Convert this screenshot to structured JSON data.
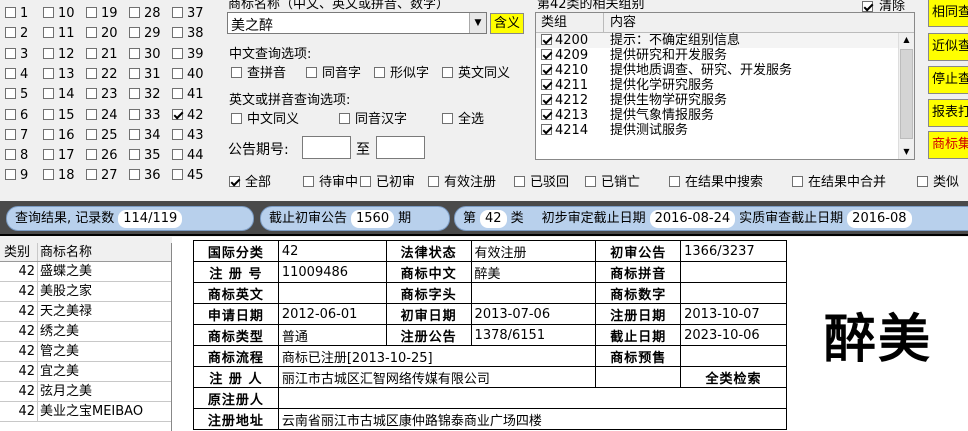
{
  "classes": [
    {
      "num": "1",
      "checked": false
    },
    {
      "num": "10",
      "checked": false
    },
    {
      "num": "19",
      "checked": false
    },
    {
      "num": "28",
      "checked": false
    },
    {
      "num": "37",
      "checked": false
    },
    {
      "num": "2",
      "checked": false
    },
    {
      "num": "11",
      "checked": false
    },
    {
      "num": "20",
      "checked": false
    },
    {
      "num": "29",
      "checked": false
    },
    {
      "num": "38",
      "checked": false
    },
    {
      "num": "3",
      "checked": false
    },
    {
      "num": "12",
      "checked": false
    },
    {
      "num": "21",
      "checked": false
    },
    {
      "num": "30",
      "checked": false
    },
    {
      "num": "39",
      "checked": false
    },
    {
      "num": "4",
      "checked": false
    },
    {
      "num": "13",
      "checked": false
    },
    {
      "num": "22",
      "checked": false
    },
    {
      "num": "31",
      "checked": false
    },
    {
      "num": "40",
      "checked": false
    },
    {
      "num": "5",
      "checked": false
    },
    {
      "num": "14",
      "checked": false
    },
    {
      "num": "23",
      "checked": false
    },
    {
      "num": "32",
      "checked": false
    },
    {
      "num": "41",
      "checked": false
    },
    {
      "num": "6",
      "checked": false
    },
    {
      "num": "15",
      "checked": false
    },
    {
      "num": "24",
      "checked": false
    },
    {
      "num": "33",
      "checked": false
    },
    {
      "num": "42",
      "checked": true
    },
    {
      "num": "7",
      "checked": false
    },
    {
      "num": "16",
      "checked": false
    },
    {
      "num": "25",
      "checked": false
    },
    {
      "num": "34",
      "checked": false
    },
    {
      "num": "43",
      "checked": false
    },
    {
      "num": "8",
      "checked": false
    },
    {
      "num": "17",
      "checked": false
    },
    {
      "num": "26",
      "checked": false
    },
    {
      "num": "35",
      "checked": false
    },
    {
      "num": "44",
      "checked": false
    },
    {
      "num": "9",
      "checked": false
    },
    {
      "num": "18",
      "checked": false
    },
    {
      "num": "27",
      "checked": false
    },
    {
      "num": "36",
      "checked": false
    },
    {
      "num": "45",
      "checked": false
    }
  ],
  "search": {
    "top_label": "商标名称（中文、英文或拼音、数字）",
    "name_value": "美之醉",
    "meaning_button": "含义",
    "cn_options_label": "中文查询选项:",
    "cn_opts": [
      "查拼音",
      "同音字",
      "形似字",
      "英文同义"
    ],
    "en_options_label": "英文或拼音查询选项:",
    "en_opts": [
      "中文同义",
      "同音汉字",
      "全选"
    ],
    "gazette_label": "公告期号:",
    "to_label": "至",
    "from_value": "",
    "to_value": ""
  },
  "group_panel": {
    "title": "第42类的相关组别",
    "clear_label": "清除",
    "col_group": "类组",
    "col_content": "内容",
    "rows": [
      {
        "code": "4200",
        "content": "提示：不确定组别信息",
        "checked": true
      },
      {
        "code": "4209",
        "content": "提供研究和开发服务",
        "checked": true
      },
      {
        "code": "4210",
        "content": "提供地质调查、研究、开发服务",
        "checked": true
      },
      {
        "code": "4211",
        "content": "提供化学研究服务",
        "checked": true
      },
      {
        "code": "4212",
        "content": "提供生物学研究服务",
        "checked": true
      },
      {
        "code": "4213",
        "content": "提供气象情报服务",
        "checked": true
      },
      {
        "code": "4214",
        "content": "提供测试服务",
        "checked": true
      }
    ]
  },
  "side_buttons": [
    "相同查",
    "近似查",
    "停止查",
    "报表打",
    "商标集"
  ],
  "filters": [
    {
      "label": "全部",
      "checked": true
    },
    {
      "label": "待审中",
      "checked": false
    },
    {
      "label": "已初审",
      "checked": false
    },
    {
      "label": "有效注册",
      "checked": false
    },
    {
      "label": "已驳回",
      "checked": false
    },
    {
      "label": "已销亡",
      "checked": false
    },
    {
      "label": "在结果中搜索",
      "checked": false
    },
    {
      "label": "在结果中合并",
      "checked": false
    },
    {
      "label": "类似",
      "checked": false
    }
  ],
  "status": {
    "result_label": "查询结果, 记录数",
    "result_value": "114/119",
    "deadline_label": "截止初审公告",
    "deadline_value": "1560",
    "deadline_unit": "期",
    "class_prefix": "第",
    "class_value": "42",
    "class_suffix": "类",
    "prelim_label": "初步审定截止日期",
    "prelim_value": "2016-08-24",
    "substantive_label": "实质审查截止日期",
    "substantive_value": "2016-08"
  },
  "list": {
    "col_class": "类别",
    "col_name": "商标名称",
    "rows": [
      {
        "cls": "42",
        "name": "盛蝶之美"
      },
      {
        "cls": "42",
        "name": "美股之家"
      },
      {
        "cls": "42",
        "name": "天之美禄"
      },
      {
        "cls": "42",
        "name": "绣之美"
      },
      {
        "cls": "42",
        "name": "管之美"
      },
      {
        "cls": "42",
        "name": "宜之美"
      },
      {
        "cls": "42",
        "name": "弦月之美"
      },
      {
        "cls": "42",
        "name": "美业之宝MEIBAO"
      }
    ]
  },
  "detail": {
    "intl_class_label": "国际分类",
    "intl_class": "42",
    "legal_status_label": "法律状态",
    "legal_status": "有效注册",
    "prelim_gazette_label": "初审公告",
    "prelim_gazette": "1366/3237",
    "reg_no_label": "注 册 号",
    "reg_no": "11009486",
    "cn_name_label": "商标中文",
    "cn_name": "醉美",
    "pinyin_label": "商标拼音",
    "pinyin": "",
    "en_name_label": "商标英文",
    "en_name": "",
    "head_char_label": "商标字头",
    "head_char": "",
    "digits_label": "商标数字",
    "digits": "",
    "apply_date_label": "申请日期",
    "apply_date": "2012-06-01",
    "prelim_date_label": "初审日期",
    "prelim_date": "2013-07-06",
    "reg_date_label": "注册日期",
    "reg_date": "2013-10-07",
    "type_label": "商标类型",
    "type": "普通",
    "reg_gazette_label": "注册公告",
    "reg_gazette": "1378/6151",
    "expiry_label": "截止日期",
    "expiry": "2023-10-06",
    "flow_label": "商标流程",
    "flow": "商标已注册[2013-10-25]",
    "presale_label": "商标预售",
    "presale": "",
    "registrant_label": "注 册 人",
    "registrant": "丽江市古城区汇智网络传媒有限公司",
    "all_class_search": "全类检索",
    "orig_registrant_label": "原注册人",
    "orig_registrant": "",
    "address_label": "注册地址",
    "address": "云南省丽江市古城区康仲路锦泰商业广场四楼"
  },
  "preview_text": "醉美"
}
